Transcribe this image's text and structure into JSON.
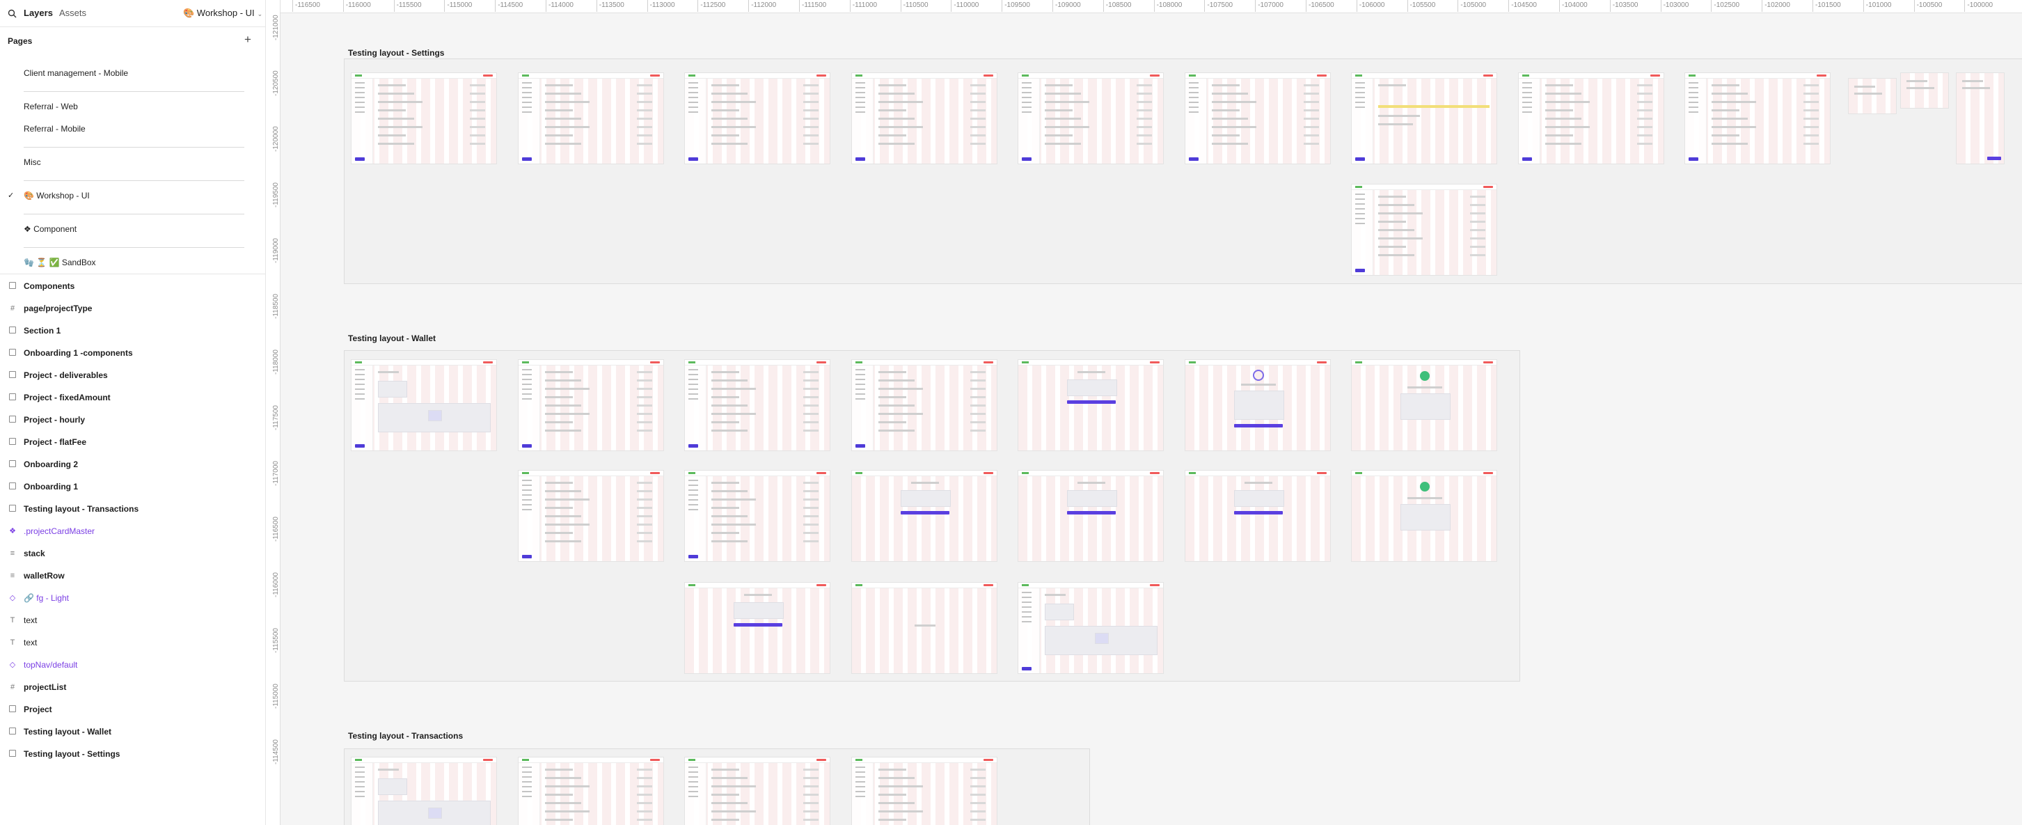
{
  "header": {
    "tab_layers": "Layers",
    "tab_assets": "Assets",
    "current_page": "🎨 Workshop - UI"
  },
  "pages": {
    "heading": "Pages",
    "items": [
      "Client management - Mobile",
      "Referral - Web",
      "Referral - Mobile",
      "Misc",
      "🎨 Workshop - UI",
      "❖ Component",
      "🧤 ⏳ ✅ SandBox"
    ]
  },
  "layers": [
    {
      "name": "Components",
      "icon": "frame-icon"
    },
    {
      "name": "page/projectType",
      "icon": "grid-frame-icon"
    },
    {
      "name": "Section 1",
      "icon": "frame-icon"
    },
    {
      "name": "Onboarding 1 -components",
      "icon": "frame-icon"
    },
    {
      "name": "Project - deliverables",
      "icon": "frame-icon"
    },
    {
      "name": "Project - fixedAmount",
      "icon": "frame-icon"
    },
    {
      "name": "Project - hourly",
      "icon": "frame-icon"
    },
    {
      "name": "Project - flatFee",
      "icon": "frame-icon"
    },
    {
      "name": "Onboarding 2",
      "icon": "frame-icon"
    },
    {
      "name": "Onboarding 1",
      "icon": "frame-icon"
    },
    {
      "name": "Testing layout - Transactions",
      "icon": "frame-icon"
    },
    {
      "name": ".projectCardMaster",
      "icon": "component-icon"
    },
    {
      "name": "stack",
      "icon": "auto-layout-icon"
    },
    {
      "name": "walletRow",
      "icon": "auto-layout-icon"
    },
    {
      "name": "🔗 fg - Light",
      "icon": "instance-icon"
    },
    {
      "name": "text",
      "icon": "text-icon"
    },
    {
      "name": "text",
      "icon": "text-icon"
    },
    {
      "name": "topNav/default",
      "icon": "instance-icon"
    },
    {
      "name": "projectList",
      "icon": "grid-frame-icon"
    },
    {
      "name": "Project",
      "icon": "frame-icon"
    },
    {
      "name": "Testing layout - Wallet",
      "icon": "frame-icon"
    },
    {
      "name": "Testing layout - Settings",
      "icon": "frame-icon"
    }
  ],
  "ruler": {
    "x_ticks": [
      "-116500",
      "-116000",
      "-115500",
      "-115000",
      "-114500",
      "-114000",
      "-113500",
      "-113000",
      "-112500",
      "-112000",
      "-111500",
      "-111000",
      "-110500",
      "-110000",
      "-109500",
      "-109000",
      "-108500",
      "-108000",
      "-107500",
      "-107000",
      "-106500",
      "-106000",
      "-105500",
      "-105000",
      "-104500",
      "-104000",
      "-103500",
      "-103000",
      "-102500",
      "-102000",
      "-101500",
      "-101000",
      "-100500",
      "-100000"
    ],
    "y_ticks": [
      "-121000",
      "-120500",
      "-120000",
      "-119500",
      "-119000",
      "-118500",
      "-118000",
      "-117500",
      "-117000",
      "-116500",
      "-116000",
      "-115500",
      "-115000",
      "-114500"
    ]
  },
  "canvas": {
    "sections": [
      {
        "title": "Testing layout - Settings"
      },
      {
        "title": "Testing layout - Wallet"
      },
      {
        "title": "Testing layout - Transactions"
      }
    ]
  },
  "colors": {
    "accent_purple": "#7b3fe4",
    "button_purple": "#4f3bd8",
    "success_green": "#3fbf7a",
    "warning_yellow": "#f2df7a"
  }
}
